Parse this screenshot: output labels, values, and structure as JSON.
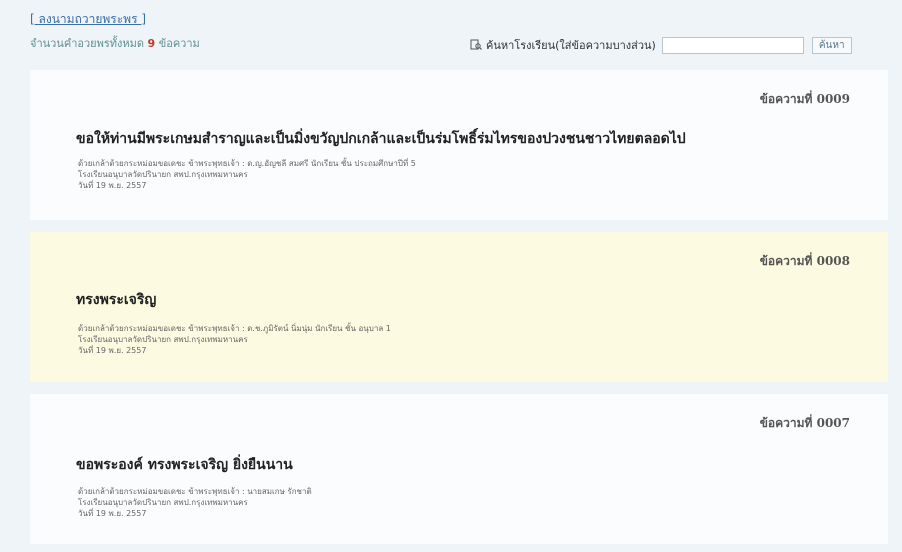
{
  "header": {
    "sign_link": "ลงนามถวายพระพร",
    "bracket_open": "[",
    "bracket_close": "]",
    "count_prefix": "จำนวนคำอวยพรทั้งหมด",
    "count_value": "9",
    "count_suffix": "ข้อความ"
  },
  "search": {
    "icon": "search-icon",
    "label": "ค้นหาโรงเรียน(ใส่ข้อความบางส่วน)",
    "input_value": "",
    "button_label": "ค้นหา"
  },
  "messages": [
    {
      "number": "ข้อความที่ 0009",
      "title": "ขอให้ท่านมีพระเกษมสำราญและเป็นมิ่งขวัญปกเกล้าและเป็นร่มโพธิ์ร่มไทรของปวงชนชาวไทยตลอดไป",
      "author": "ด้วยเกล้าด้วยกระหม่อมขอเดชะ ข้าพระพุทธเจ้า : ด.ญ.อัญชลี สมศรี นักเรียน ชั้น ประถมศึกษาปีที่ 5",
      "school": "โรงเรียนอนุบาลวัดปรินายก สพป.กรุงเทพมหานคร",
      "date": "วันที่ 19 พ.ย. 2557"
    },
    {
      "number": "ข้อความที่ 0008",
      "title": "ทรงพระเจริญ",
      "author": "ด้วยเกล้าด้วยกระหม่อมขอเดชะ ข้าพระพุทธเจ้า : ด.ช.ภูมิรัตน์ นิ่มนุ่ม นักเรียน ชั้น อนุบาล 1",
      "school": "โรงเรียนอนุบาลวัดปรินายก สพป.กรุงเทพมหานคร",
      "date": "วันที่ 19 พ.ย. 2557"
    },
    {
      "number": "ข้อความที่ 0007",
      "title": "ขอพระองค์ ทรงพระเจริญ ยิ่งยืนนาน",
      "author": "ด้วยเกล้าด้วยกระหม่อมขอเดชะ ข้าพระพุทธเจ้า : นายสมเกษ รักชาติ",
      "school": "โรงเรียนอนุบาลวัดปรินายก สพป.กรุงเทพมหานคร",
      "date": "วันที่ 19 พ.ย. 2557"
    }
  ]
}
